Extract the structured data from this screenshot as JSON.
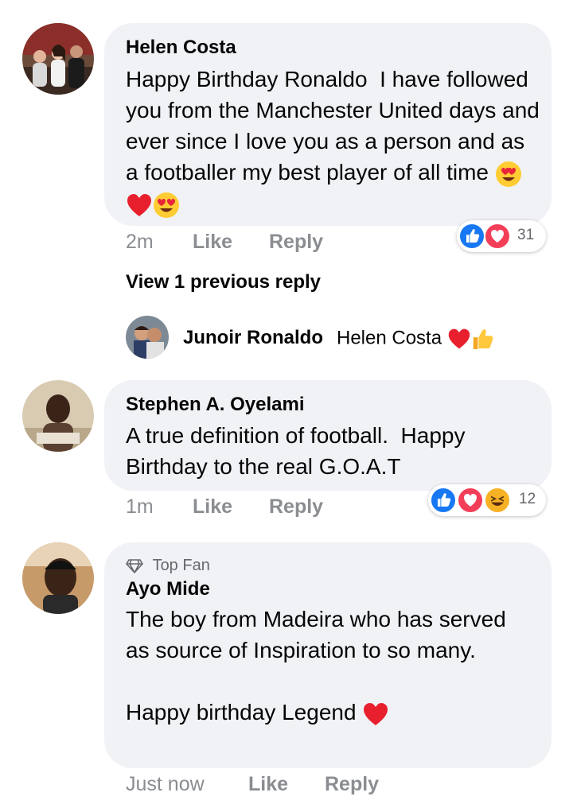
{
  "comments": [
    {
      "author": "Helen Costa",
      "text": "Happy Birthday Ronaldo  I have followed you from the Manchester United days and ever since I love you as a person and as a footballer my best player of all time",
      "emojis": [
        "heart-eyes-emoji",
        "red-heart-emoji",
        "heart-eyes-emoji"
      ],
      "time": "2m",
      "like": "Like",
      "reply": "Reply",
      "reactions": [
        "like",
        "love"
      ],
      "reaction_count": "31"
    },
    {
      "author": "Stephen A. Oyelami",
      "text": "A true definition of football.  Happy Birthday to the real G.O.A.T",
      "time": "1m",
      "like": "Like",
      "reply": "Reply",
      "reactions": [
        "like",
        "love",
        "haha"
      ],
      "reaction_count": "12"
    },
    {
      "badge": "Top Fan",
      "author": "Ayo Mide",
      "text": "The boy from Madeira who has served as source of Inspiration to so many.\n\nHappy birthday Legend",
      "emojis": [
        "red-heart-emoji"
      ],
      "time": "Just now",
      "like": "Like",
      "reply": "Reply"
    }
  ],
  "view_previous": "View 1 previous reply",
  "reply_preview": {
    "author": "Junoir Ronaldo",
    "text": "Helen Costa",
    "emojis": [
      "red-heart-emoji",
      "thumbs-up-emoji"
    ]
  },
  "colors": {
    "bubble": "#f0f2f5",
    "meta": "#8a8d91",
    "like_blue": "#1877f2",
    "love_red": "#f33e58",
    "haha_yellow": "#f7b125"
  }
}
